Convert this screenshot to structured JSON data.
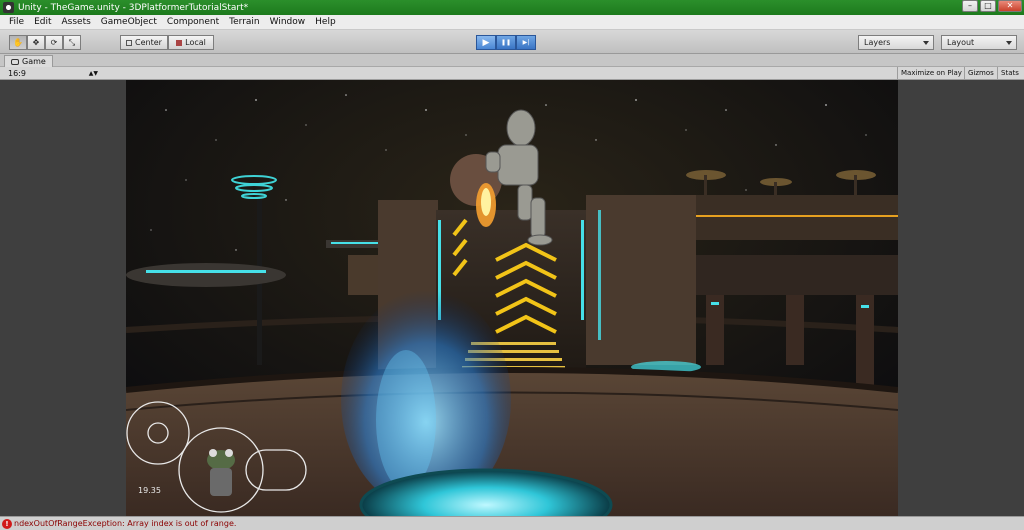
{
  "window": {
    "title": "Unity - TheGame.unity - 3DPlatformerTutorialStart*",
    "controls": {
      "minimize": "–",
      "maximize": "□",
      "close": "✕"
    }
  },
  "menu": {
    "items": [
      {
        "label": "File"
      },
      {
        "label": "Edit"
      },
      {
        "label": "Assets"
      },
      {
        "label": "GameObject"
      },
      {
        "label": "Component"
      },
      {
        "label": "Terrain"
      },
      {
        "label": "Window"
      },
      {
        "label": "Help"
      }
    ]
  },
  "toolbar": {
    "tools": [
      {
        "icon": "hand-icon",
        "glyph": "✋"
      },
      {
        "icon": "move-icon",
        "glyph": "✥"
      },
      {
        "icon": "rotate-icon",
        "glyph": "⟳"
      },
      {
        "icon": "scale-icon",
        "glyph": "⤡"
      }
    ],
    "pivot_label": "Center",
    "space_label": "Local",
    "play": {
      "play_glyph": "▶",
      "pause_glyph": "❚❚",
      "step_glyph": "▶|"
    },
    "layers_label": "Layers",
    "layout_label": "Layout"
  },
  "game_panel": {
    "tab_label": "Game",
    "aspect": "16:9",
    "maximize_on_play": "Maximize on Play",
    "gizmos": "Gizmos",
    "stats": "Stats",
    "timer": "19.35"
  },
  "status": {
    "error_glyph": "!",
    "message": "ndexOutOfRangeException: Array index is out of range."
  },
  "colors": {
    "title_bar": "#1d7a1d",
    "play_button": "#3a74c4",
    "error": "#d11a1a"
  }
}
